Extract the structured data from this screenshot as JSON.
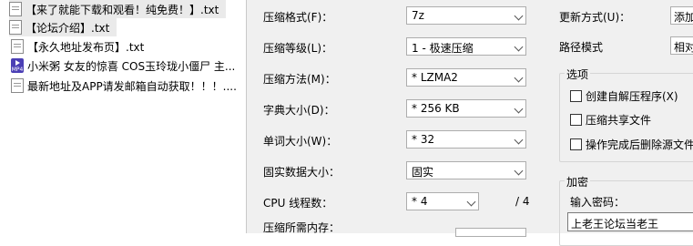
{
  "files": [
    {
      "name": "【来了就能下载和观看！纯免费！】.txt",
      "icon": "txt"
    },
    {
      "name": "【论坛介绍】.txt",
      "icon": "txt"
    },
    {
      "name": "【永久地址发布页】.txt",
      "icon": "txt"
    },
    {
      "name": "小米粥 女友的惊喜 COS玉玲珑小僵尸 主...",
      "icon": "mp4"
    },
    {
      "name": "最新地址及APP请发邮箱自动获取！！！....",
      "icon": "txt"
    }
  ],
  "dialog": {
    "format_label": "压缩格式(F)：",
    "format_value": "7z",
    "level_label": "压缩等级(L)：",
    "level_value": "1 - 极速压缩",
    "method_label": "压缩方法(M)：",
    "method_value": "* LZMA2",
    "dict_label": "字典大小(D)：",
    "dict_value": "* 256 KB",
    "word_label": "单词大小(W)：",
    "word_value": "* 32",
    "solid_label": "固实数据大小：",
    "solid_value": "固实",
    "threads_label": "CPU 线程数：",
    "threads_value": "* 4",
    "threads_total": "/ 4",
    "memory_label": "压缩所需内存：",
    "update_label": "更新方式(U)：",
    "update_value": "添加",
    "path_label": "路径模式",
    "path_value": "相对",
    "options_title": "选项",
    "opt_sfx": "创建自解压程序(X)",
    "opt_shared": "压缩共享文件",
    "opt_delete": "操作完成后删除源文件",
    "encrypt_title": "加密",
    "password_label": "输入密码：",
    "password_value": "上老王论坛当老王"
  }
}
